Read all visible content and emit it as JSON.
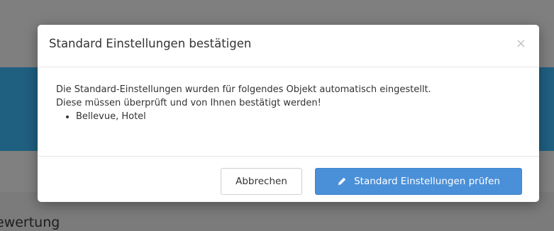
{
  "background": {
    "heading_fragment": "ewertung"
  },
  "modal": {
    "title": "Standard Einstellungen bestätigen",
    "close_symbol": "×",
    "body_line1": "Die Standard-Einstellungen wurden für folgendes Objekt automatisch eingestellt.",
    "body_line2": "Diese müssen überprüft und von Ihnen bestätigt werden!",
    "items": [
      "Bellevue, Hotel"
    ],
    "cancel_label": "Abbrechen",
    "confirm_label": "Standard Einstellungen prüfen",
    "confirm_icon": "pencil-icon"
  },
  "colors": {
    "primary": "#4a90d9",
    "header_band": "#1f5f80"
  }
}
